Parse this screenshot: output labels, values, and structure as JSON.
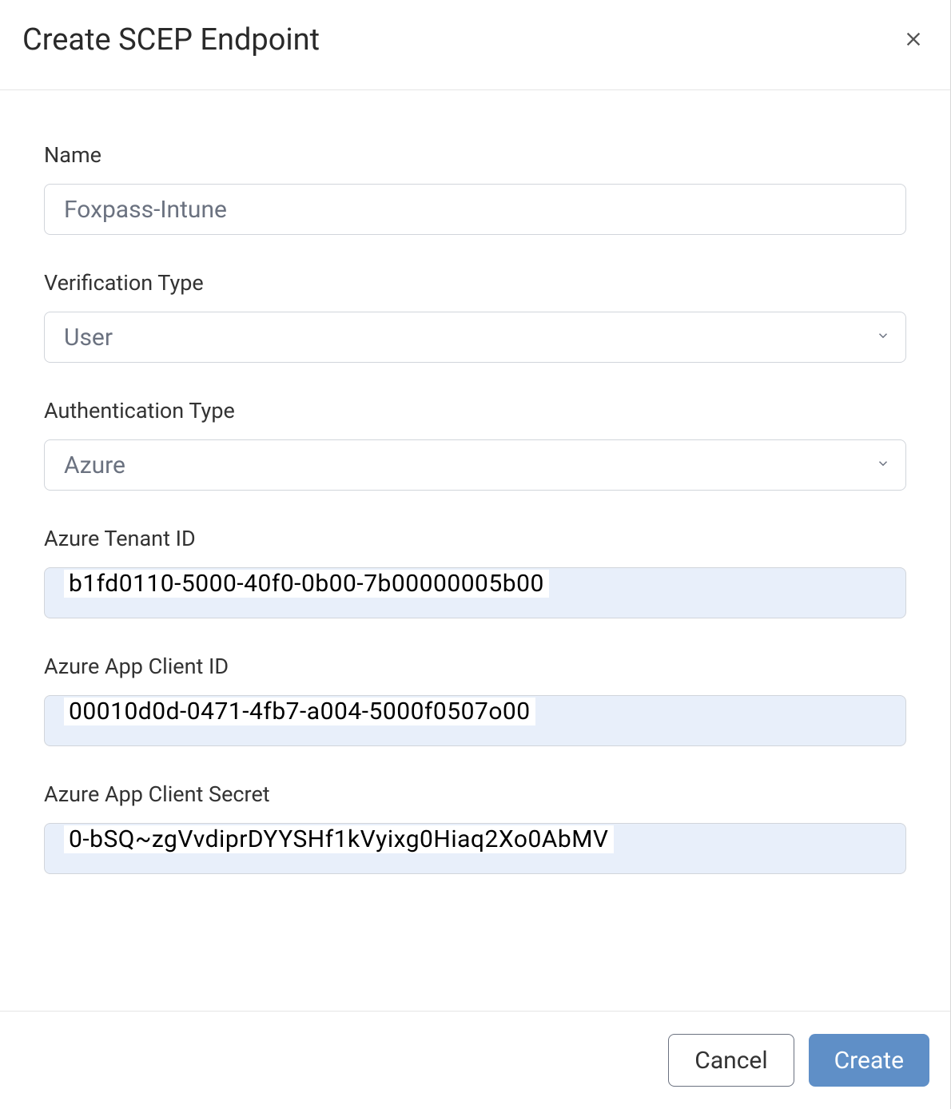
{
  "modal": {
    "title": "Create SCEP Endpoint"
  },
  "fields": {
    "name": {
      "label": "Name",
      "value": "Foxpass-Intune"
    },
    "verification_type": {
      "label": "Verification Type",
      "value": "User"
    },
    "authentication_type": {
      "label": "Authentication Type",
      "value": "Azure"
    },
    "azure_tenant_id": {
      "label": "Azure Tenant ID",
      "value": "b1fd0110-5000-40f0-0b00-7b00000005b00"
    },
    "azure_app_client_id": {
      "label": "Azure App Client ID",
      "value": "00010d0d-0471-4fb7-a004-5000f0507o00"
    },
    "azure_app_client_secret": {
      "label": "Azure App Client Secret",
      "value": "0-bSQ~zgVvdiprDYYSHf1kVyixg0Hiaq2Xo0AbMV"
    }
  },
  "actions": {
    "cancel": "Cancel",
    "create": "Create"
  }
}
